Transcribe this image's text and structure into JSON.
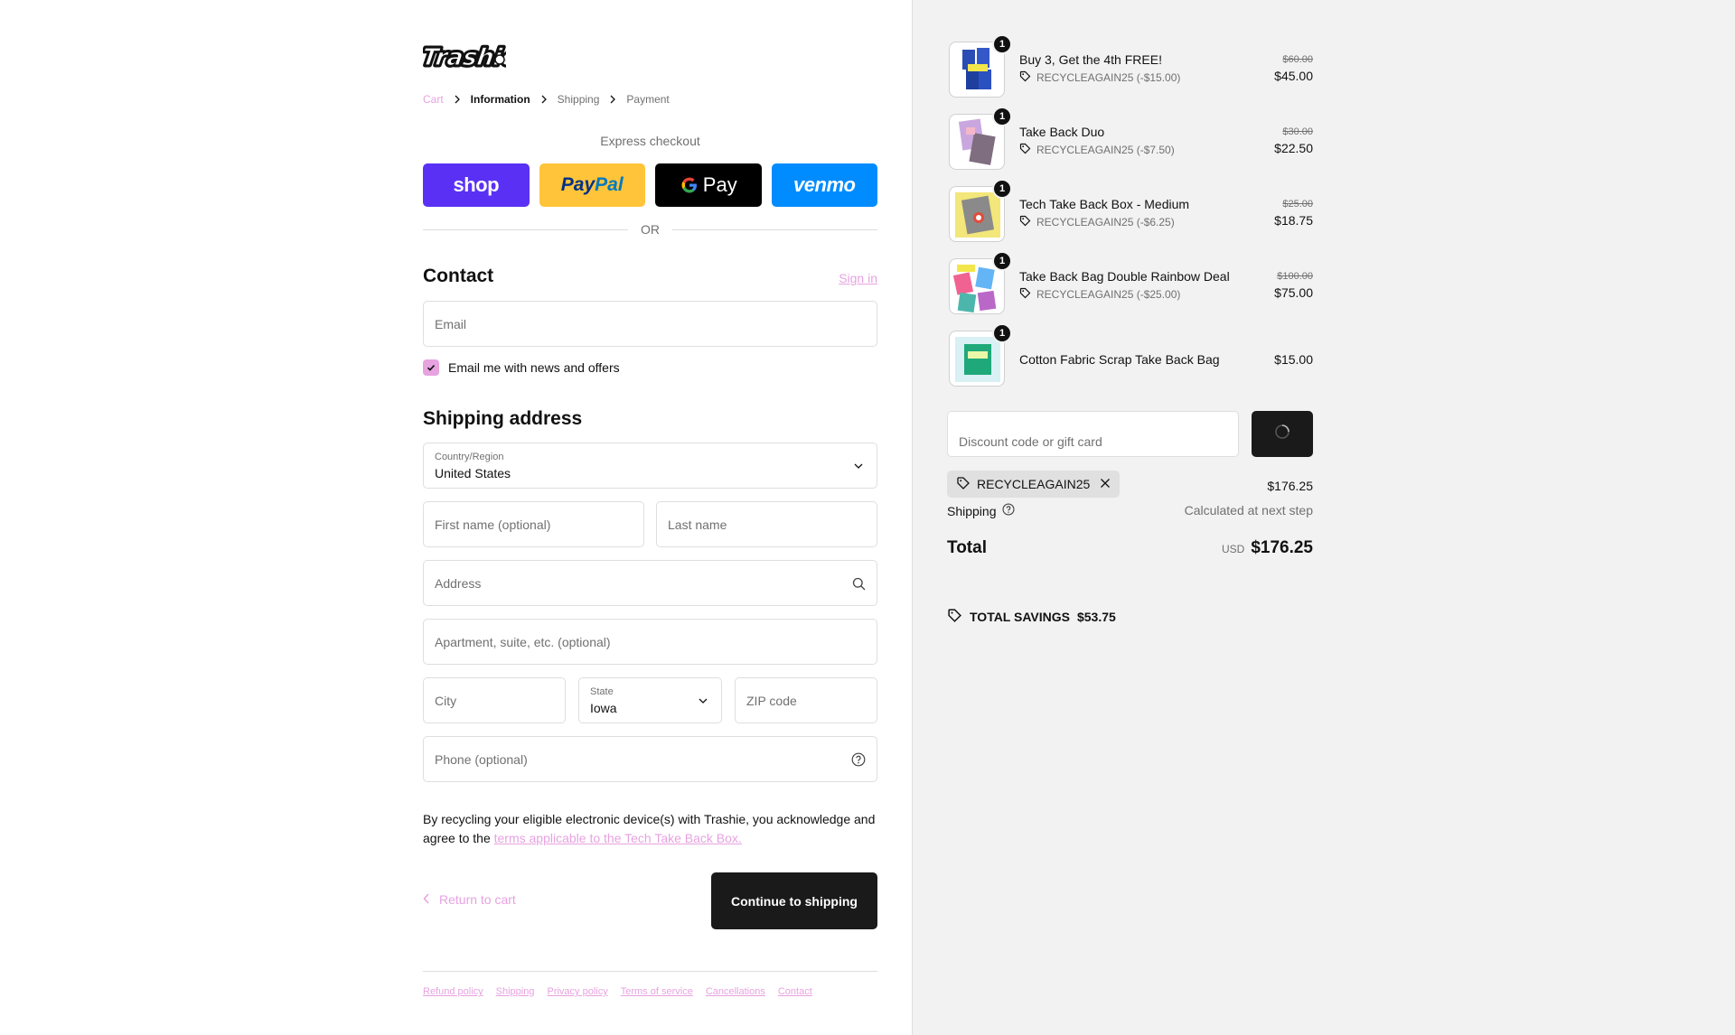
{
  "brand": {
    "logo_text": "Trashie"
  },
  "breadcrumb": {
    "items": [
      "Cart",
      "Information",
      "Shipping",
      "Payment"
    ]
  },
  "express": {
    "title": "Express checkout",
    "shop": "shop",
    "paypal_a": "Pay",
    "paypal_b": "Pal",
    "gpay": "Pay",
    "venmo": "venmo",
    "or": "OR"
  },
  "contact": {
    "heading": "Contact",
    "sign_in": "Sign in",
    "email_placeholder": "Email",
    "news_label": "Email me with news and offers",
    "news_checked": true
  },
  "shipping_address": {
    "heading": "Shipping address",
    "country_label": "Country/Region",
    "country_value": "United States",
    "first_name_placeholder": "First name (optional)",
    "last_name_placeholder": "Last name",
    "address_placeholder": "Address",
    "apartment_placeholder": "Apartment, suite, etc. (optional)",
    "city_placeholder": "City",
    "state_label": "State",
    "state_value": "Iowa",
    "zip_placeholder": "ZIP code",
    "phone_placeholder": "Phone (optional)"
  },
  "consent": {
    "text": "By recycling your eligible electronic device(s) with Trashie, you acknowledge and agree to the ",
    "link": "terms applicable to the Tech Take Back Box."
  },
  "actions": {
    "return_label": "Return to cart",
    "continue_label": "Continue to shipping"
  },
  "footer": {
    "links": [
      "Refund policy",
      "Shipping",
      "Privacy policy",
      "Terms of service",
      "Cancellations",
      "Contact"
    ]
  },
  "order": {
    "items": [
      {
        "name": "Buy 3, Get the 4th FREE!",
        "discount": "RECYCLEAGAIN25 (-$15.00)",
        "original": "$60.00",
        "price": "$45.00",
        "qty": "1"
      },
      {
        "name": "Take Back Duo",
        "discount": "RECYCLEAGAIN25 (-$7.50)",
        "original": "$30.00",
        "price": "$22.50",
        "qty": "1"
      },
      {
        "name": "Tech Take Back Box - Medium",
        "discount": "RECYCLEAGAIN25 (-$6.25)",
        "original": "$25.00",
        "price": "$18.75",
        "qty": "1"
      },
      {
        "name": "Take Back Bag Double Rainbow Deal",
        "discount": "RECYCLEAGAIN25 (-$25.00)",
        "original": "$100.00",
        "price": "$75.00",
        "qty": "1"
      },
      {
        "name": "Cotton Fabric Scrap Take Back Bag",
        "price": "$15.00",
        "qty": "1"
      }
    ],
    "discount_placeholder": "Discount code or gift card",
    "applied_code": "RECYCLEAGAIN25",
    "subtotal": "$176.25",
    "shipping_label": "Shipping",
    "shipping_value": "Calculated at next step",
    "total_label": "Total",
    "currency": "USD",
    "total": "$176.25",
    "savings_label": "TOTAL SAVINGS",
    "savings_value": "$53.75"
  },
  "colors": {
    "accent_pink": "#e7a2e0",
    "shop": "#5a31f4",
    "paypal": "#ffc439",
    "venmo": "#008cff",
    "dark": "#1a1a1a"
  }
}
